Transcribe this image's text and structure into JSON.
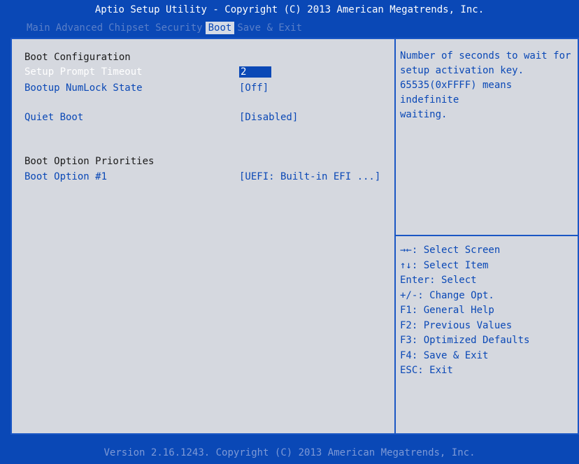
{
  "header": {
    "title": "Aptio Setup Utility - Copyright (C) 2013 American Megatrends, Inc."
  },
  "tabs": [
    {
      "label": "Main",
      "active": false
    },
    {
      "label": "Advanced",
      "active": false
    },
    {
      "label": "Chipset",
      "active": false
    },
    {
      "label": "Security",
      "active": false
    },
    {
      "label": "Boot",
      "active": true
    },
    {
      "label": "Save & Exit",
      "active": false
    }
  ],
  "boot": {
    "section_config": "Boot Configuration",
    "setup_prompt_label": "Setup Prompt Timeout",
    "setup_prompt_value": "2",
    "numlock_label": "Bootup NumLock State",
    "numlock_value": "[Off]",
    "quiet_label": "Quiet Boot",
    "quiet_value": "[Disabled]",
    "section_priorities": "Boot Option Priorities",
    "option1_label": "Boot Option #1",
    "option1_value": "[UEFI: Built-in EFI ...]"
  },
  "help": {
    "lines": [
      "Number of seconds to wait for",
      "setup activation key.",
      "65535(0xFFFF) means indefinite",
      "waiting."
    ]
  },
  "keys": [
    "→←: Select Screen",
    "↑↓: Select Item",
    "Enter: Select",
    "+/-: Change Opt.",
    "F1: General Help",
    "F2: Previous Values",
    "F3: Optimized Defaults",
    "F4: Save & Exit",
    "ESC: Exit"
  ],
  "footer": {
    "text": "Version 2.16.1243. Copyright (C) 2013 American Megatrends, Inc."
  },
  "colors": {
    "background": "#0a48b6",
    "panel": "#d5d8df",
    "accent": "#0a48b6"
  }
}
